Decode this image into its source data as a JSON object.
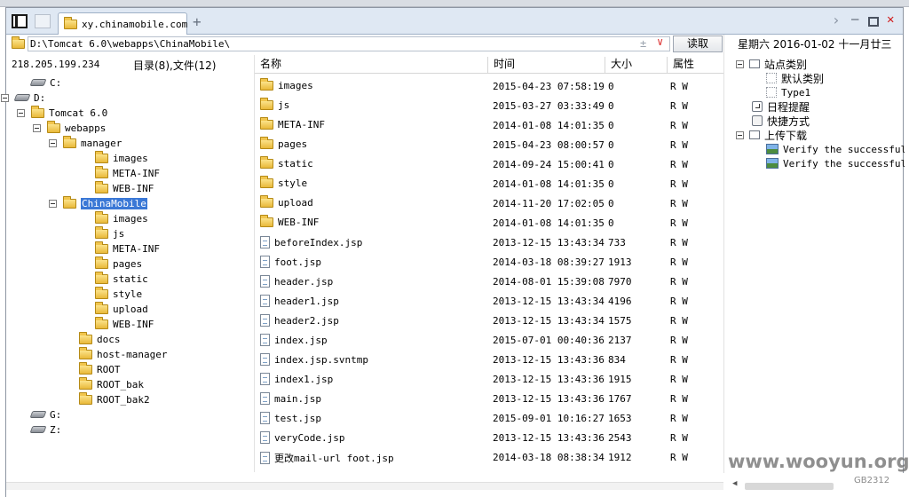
{
  "tab": {
    "title": "xy.chinamobile.com"
  },
  "address": {
    "path": "D:\\Tomcat 6.0\\webapps\\ChinaMobile\\",
    "read_label": "读取"
  },
  "date_label": "星期六 2016-01-02 十一月廿三",
  "status": {
    "ip": "218.205.199.234",
    "count": "目录(8),文件(12)"
  },
  "columns": {
    "name": "名称",
    "time": "时间",
    "size": "大小",
    "attr": "属性"
  },
  "tree": [
    {
      "label": "C:",
      "icon": "drive-icon",
      "toggle": false
    },
    {
      "label": "D:",
      "icon": "drive-icon",
      "toggle": true
    },
    {
      "label": "Tomcat 6.0",
      "icon": "folder-icon",
      "toggle": true
    },
    {
      "label": "webapps",
      "icon": "folder-icon",
      "toggle": true
    },
    {
      "label": "manager",
      "icon": "folder-icon",
      "toggle": true
    },
    {
      "label": "images",
      "icon": "folder-icon",
      "toggle": false
    },
    {
      "label": "META-INF",
      "icon": "folder-icon",
      "toggle": false
    },
    {
      "label": "WEB-INF",
      "icon": "folder-icon",
      "toggle": false
    },
    {
      "label": "ChinaMobile",
      "icon": "folder-icon",
      "toggle": true,
      "selected": true
    },
    {
      "label": "images",
      "icon": "folder-icon",
      "toggle": false
    },
    {
      "label": "js",
      "icon": "folder-icon",
      "toggle": false
    },
    {
      "label": "META-INF",
      "icon": "folder-icon",
      "toggle": false
    },
    {
      "label": "pages",
      "icon": "folder-icon",
      "toggle": false
    },
    {
      "label": "static",
      "icon": "folder-icon",
      "toggle": false
    },
    {
      "label": "style",
      "icon": "folder-icon",
      "toggle": false
    },
    {
      "label": "upload",
      "icon": "folder-icon",
      "toggle": false
    },
    {
      "label": "WEB-INF",
      "icon": "folder-icon",
      "toggle": false
    },
    {
      "label": "docs",
      "icon": "folder-icon",
      "toggle": false
    },
    {
      "label": "host-manager",
      "icon": "folder-icon",
      "toggle": false
    },
    {
      "label": "ROOT",
      "icon": "folder-icon",
      "toggle": false
    },
    {
      "label": "ROOT_bak",
      "icon": "folder-icon",
      "toggle": false
    },
    {
      "label": "ROOT_bak2",
      "icon": "folder-icon",
      "toggle": false
    },
    {
      "label": "G:",
      "icon": "drive-icon",
      "toggle": false
    },
    {
      "label": "Z:",
      "icon": "drive-icon",
      "toggle": false
    }
  ],
  "files": [
    {
      "name": "images",
      "type": "folder",
      "time": "2015-04-23 07:58:19",
      "size": "0",
      "attr": "R W"
    },
    {
      "name": "js",
      "type": "folder",
      "time": "2015-03-27 03:33:49",
      "size": "0",
      "attr": "R W"
    },
    {
      "name": "META-INF",
      "type": "folder",
      "time": "2014-01-08 14:01:35",
      "size": "0",
      "attr": "R W"
    },
    {
      "name": "pages",
      "type": "folder",
      "time": "2015-04-23 08:00:57",
      "size": "0",
      "attr": "R W"
    },
    {
      "name": "static",
      "type": "folder",
      "time": "2014-09-24 15:00:41",
      "size": "0",
      "attr": "R W"
    },
    {
      "name": "style",
      "type": "folder",
      "time": "2014-01-08 14:01:35",
      "size": "0",
      "attr": "R W"
    },
    {
      "name": "upload",
      "type": "folder",
      "time": "2014-11-20 17:02:05",
      "size": "0",
      "attr": "R W"
    },
    {
      "name": "WEB-INF",
      "type": "folder",
      "time": "2014-01-08 14:01:35",
      "size": "0",
      "attr": "R W"
    },
    {
      "name": "beforeIndex.jsp",
      "type": "file",
      "time": "2013-12-15 13:43:34",
      "size": "733",
      "attr": "R W"
    },
    {
      "name": "foot.jsp",
      "type": "file",
      "time": "2014-03-18 08:39:27",
      "size": "1913",
      "attr": "R W"
    },
    {
      "name": "header.jsp",
      "type": "file",
      "time": "2014-08-01 15:39:08",
      "size": "7970",
      "attr": "R W"
    },
    {
      "name": "header1.jsp",
      "type": "file",
      "time": "2013-12-15 13:43:34",
      "size": "4196",
      "attr": "R W"
    },
    {
      "name": "header2.jsp",
      "type": "file",
      "time": "2013-12-15 13:43:34",
      "size": "1575",
      "attr": "R W"
    },
    {
      "name": "index.jsp",
      "type": "file",
      "time": "2015-07-01 00:40:36",
      "size": "2137",
      "attr": "R W"
    },
    {
      "name": "index.jsp.svntmp",
      "type": "file",
      "time": "2013-12-15 13:43:36",
      "size": "834",
      "attr": "R W"
    },
    {
      "name": "index1.jsp",
      "type": "file",
      "time": "2013-12-15 13:43:36",
      "size": "1915",
      "attr": "R W"
    },
    {
      "name": "main.jsp",
      "type": "file",
      "time": "2013-12-15 13:43:36",
      "size": "1767",
      "attr": "R W"
    },
    {
      "name": "test.jsp",
      "type": "file",
      "time": "2015-09-01 10:16:27",
      "size": "1653",
      "attr": "R W"
    },
    {
      "name": "veryCode.jsp",
      "type": "file",
      "time": "2013-12-15 13:43:36",
      "size": "2543",
      "attr": "R W"
    },
    {
      "name": "更改mail-url foot.jsp",
      "type": "file",
      "time": "2014-03-18 08:38:34",
      "size": "1912",
      "attr": "R W"
    }
  ],
  "side_tree": [
    {
      "label": "站点类别",
      "icon": "box-icon",
      "toggle": true,
      "mono": false
    },
    {
      "label": "默认类别",
      "icon": "dotted-box-icon",
      "toggle": false,
      "mono": false
    },
    {
      "label": "Type1",
      "icon": "dotted-box-icon",
      "toggle": false,
      "mono": true
    },
    {
      "label": "日程提醒",
      "icon": "clock-icon",
      "toggle": false,
      "mono": false
    },
    {
      "label": "快捷方式",
      "icon": "pointer-icon",
      "toggle": false,
      "mono": false
    },
    {
      "label": "上传下载",
      "icon": "box-icon",
      "toggle": true,
      "mono": false
    },
    {
      "label": "Verify the successful u",
      "icon": "image-icon",
      "toggle": false,
      "mono": true
    },
    {
      "label": "Verify the successful u",
      "icon": "image-icon",
      "toggle": false,
      "mono": true
    }
  ],
  "watermark": {
    "main": "www.wooyun.org",
    "sub": "GB2312"
  }
}
